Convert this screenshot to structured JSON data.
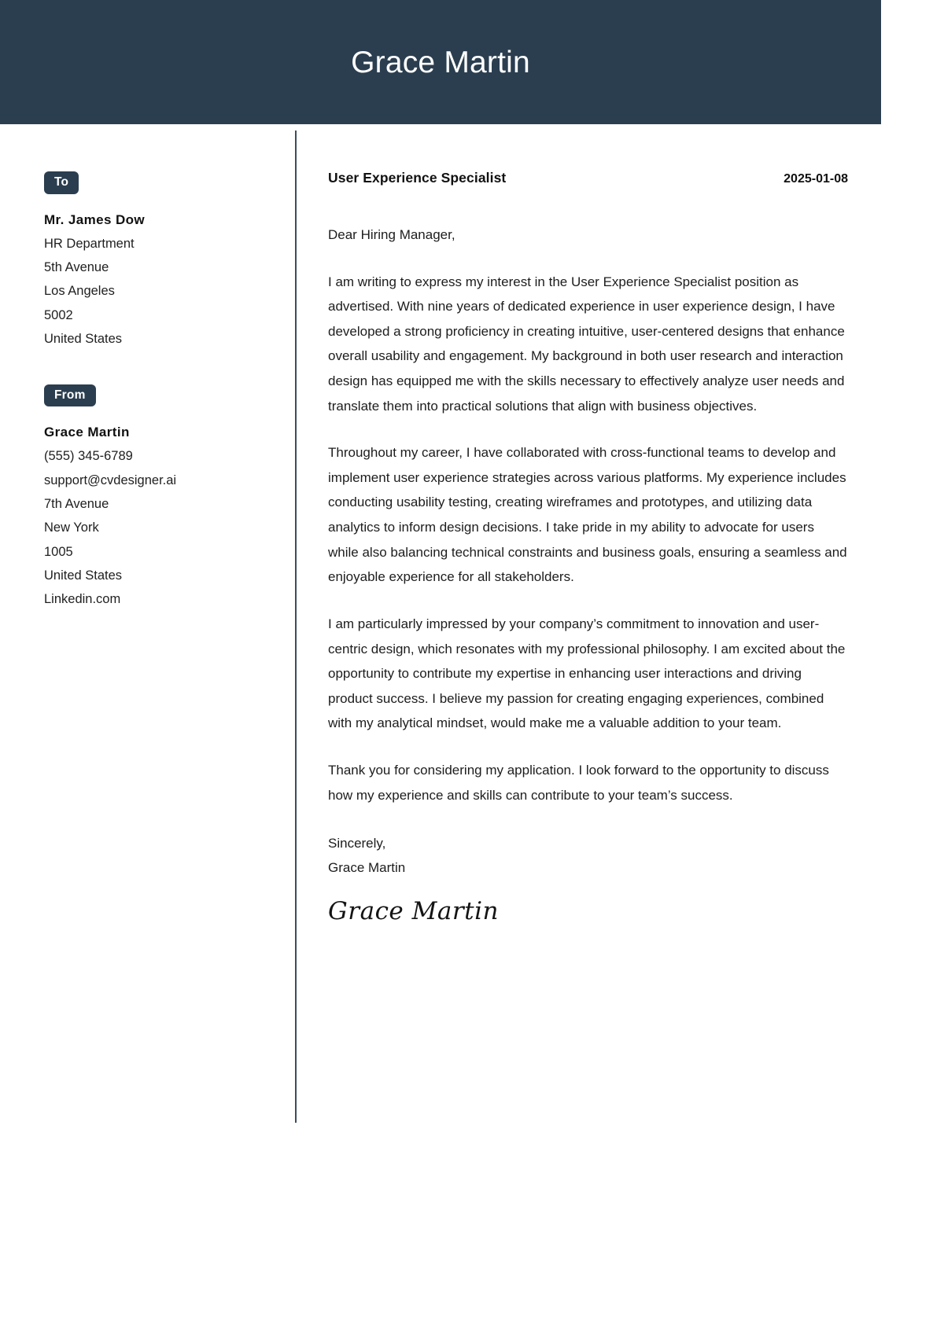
{
  "header": {
    "name": "Grace Martin"
  },
  "sidebar": {
    "to": {
      "tag_label": "To",
      "name": "Mr. James Dow",
      "lines": [
        "HR Department",
        "5th Avenue",
        "Los Angeles",
        "5002",
        "United States"
      ]
    },
    "from": {
      "tag_label": "From",
      "name": "Grace Martin",
      "lines": [
        "(555) 345-6789",
        "support@cvdesigner.ai",
        "7th Avenue",
        "New York",
        "1005",
        "United States",
        "Linkedin.com"
      ]
    }
  },
  "letter": {
    "job_title": "User Experience Specialist",
    "date": "2025-01-08",
    "salutation": "Dear Hiring Manager,",
    "paragraphs": [
      "I am writing to express my interest in the User Experience Specialist position as advertised. With nine years of dedicated experience in user experience design, I have developed a strong proficiency in creating intuitive, user-centered designs that enhance overall usability and engagement. My background in both user research and interaction design has equipped me with the skills necessary to effectively analyze user needs and translate them into practical solutions that align with business objectives.",
      "Throughout my career, I have collaborated with cross-functional teams to develop and implement user experience strategies across various platforms. My experience includes conducting usability testing, creating wireframes and prototypes, and utilizing data analytics to inform design decisions. I take pride in my ability to advocate for users while also balancing technical constraints and business goals, ensuring a seamless and enjoyable experience for all stakeholders.",
      "I am particularly impressed by your company’s commitment to innovation and user-centric design, which resonates with my professional philosophy. I am excited about the opportunity to contribute my expertise in enhancing user interactions and driving product success. I believe my passion for creating engaging experiences, combined with my analytical mindset, would make me a valuable addition to your team.",
      "Thank you for considering my application. I look forward to the opportunity to discuss how my experience and skills can contribute to your team’s success."
    ],
    "closing_salutation": "Sincerely,",
    "closing_name": "Grace Martin",
    "signature": "Grace Martin"
  },
  "colors": {
    "header_background": "#2b3e50",
    "tag_background": "#2b3e50",
    "divider": "#3b4d60",
    "text": "#1d1d1d",
    "page_background": "#ffffff"
  }
}
